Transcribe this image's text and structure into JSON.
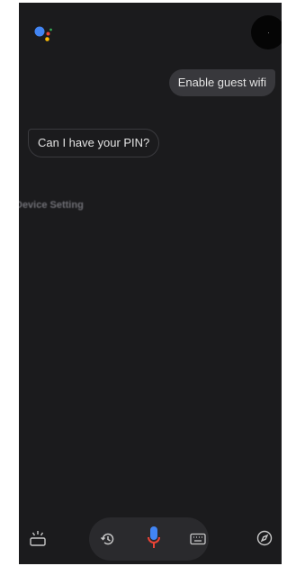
{
  "conversation": {
    "user_message": "Enable guest wifi",
    "assistant_message": "Can I have your PIN?",
    "suggestion": "Device Setting"
  },
  "bottom_bar": {
    "icons": [
      "snapshot-icon",
      "history-icon",
      "microphone-icon",
      "keyboard-icon",
      "explore-icon"
    ]
  },
  "colors": {
    "background": "#1b1b1d",
    "user_bubble": "#38383c",
    "google_blue": "#4285f4",
    "google_red": "#ea4335",
    "google_yellow": "#fbbc05",
    "google_green": "#34a853"
  }
}
